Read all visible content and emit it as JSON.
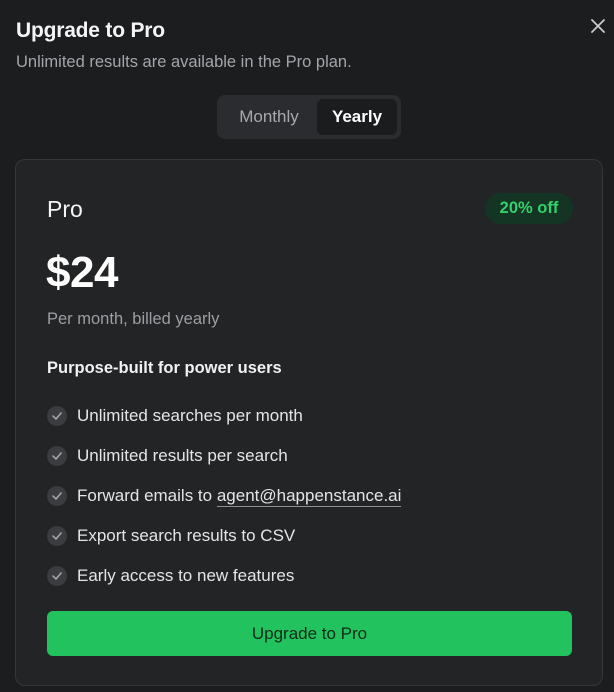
{
  "dialog": {
    "title": "Upgrade to Pro",
    "subtitle": "Unlimited results are available in the Pro plan.",
    "close_icon": "close-icon"
  },
  "billing_toggle": {
    "options": [
      "Monthly",
      "Yearly"
    ],
    "selected": "Yearly"
  },
  "plan": {
    "name": "Pro",
    "badge": "20% off",
    "price": "$24",
    "price_note": "Per month, billed yearly",
    "features_heading": "Purpose-built for power users",
    "features": [
      "Unlimited searches per month",
      "Unlimited results per search",
      "Forward emails to ",
      "Export search results to CSV",
      "Early access to new features"
    ],
    "email_link": "agent@happenstance.ai",
    "cta": "Upgrade to Pro"
  },
  "colors": {
    "background": "#1c1d1f",
    "card": "#232426",
    "accent_green": "#22c35e",
    "badge_text": "#35d06b",
    "badge_bg": "#143524"
  }
}
